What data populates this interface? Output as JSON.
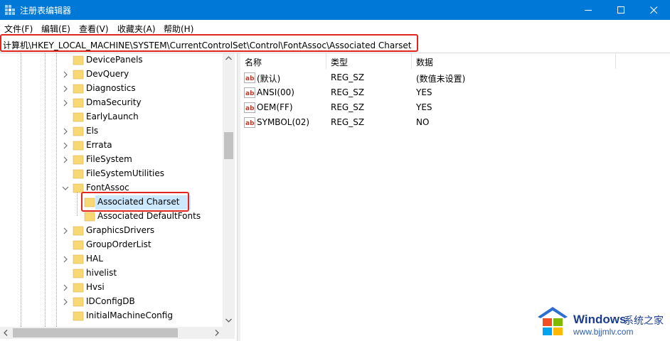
{
  "window": {
    "title": "注册表编辑器"
  },
  "menu": [
    "文件(F)",
    "编辑(E)",
    "查看(V)",
    "收藏夹(A)",
    "帮助(H)"
  ],
  "address": {
    "path": "计算机\\HKEY_LOCAL_MACHINE\\SYSTEM\\CurrentControlSet\\Control\\FontAssoc\\Associated Charset"
  },
  "tree": {
    "items": [
      {
        "label": "DevicePanels",
        "expander": "none"
      },
      {
        "label": "DevQuery",
        "expander": "collapsed"
      },
      {
        "label": "Diagnostics",
        "expander": "collapsed"
      },
      {
        "label": "DmaSecurity",
        "expander": "collapsed"
      },
      {
        "label": "EarlyLaunch",
        "expander": "none"
      },
      {
        "label": "Els",
        "expander": "collapsed"
      },
      {
        "label": "Errata",
        "expander": "collapsed"
      },
      {
        "label": "FileSystem",
        "expander": "collapsed"
      },
      {
        "label": "FileSystemUtilities",
        "expander": "none"
      },
      {
        "label": "FontAssoc",
        "expander": "expanded"
      },
      {
        "label": "Associated Charset",
        "expander": "none",
        "child": true,
        "selected": true
      },
      {
        "label": "Associated DefaultFonts",
        "expander": "none",
        "child": true
      },
      {
        "label": "GraphicsDrivers",
        "expander": "collapsed"
      },
      {
        "label": "GroupOrderList",
        "expander": "none"
      },
      {
        "label": "HAL",
        "expander": "collapsed"
      },
      {
        "label": "hivelist",
        "expander": "none"
      },
      {
        "label": "Hvsi",
        "expander": "collapsed"
      },
      {
        "label": "IDConfigDB",
        "expander": "collapsed"
      },
      {
        "label": "InitialMachineConfig",
        "expander": "none"
      }
    ]
  },
  "list": {
    "columns": [
      "名称",
      "类型",
      "数据"
    ],
    "rows": [
      {
        "name": "(默认)",
        "type": "REG_SZ",
        "data": "(数值未设置)"
      },
      {
        "name": "ANSI(00)",
        "type": "REG_SZ",
        "data": "YES"
      },
      {
        "name": "OEM(FF)",
        "type": "REG_SZ",
        "data": "YES"
      },
      {
        "name": "SYMBOL(02)",
        "type": "REG_SZ",
        "data": "NO"
      }
    ]
  },
  "icons": {
    "value_icon_label": "ab",
    "folder_color": "#f8d775",
    "titlebar_color": "#0078d7",
    "highlight_color": "#e0261e",
    "selection_color": "#cce8ff"
  },
  "watermark": {
    "brand": "Windows",
    "cn": "系统之家",
    "url": "www.bjjmlv.com"
  }
}
